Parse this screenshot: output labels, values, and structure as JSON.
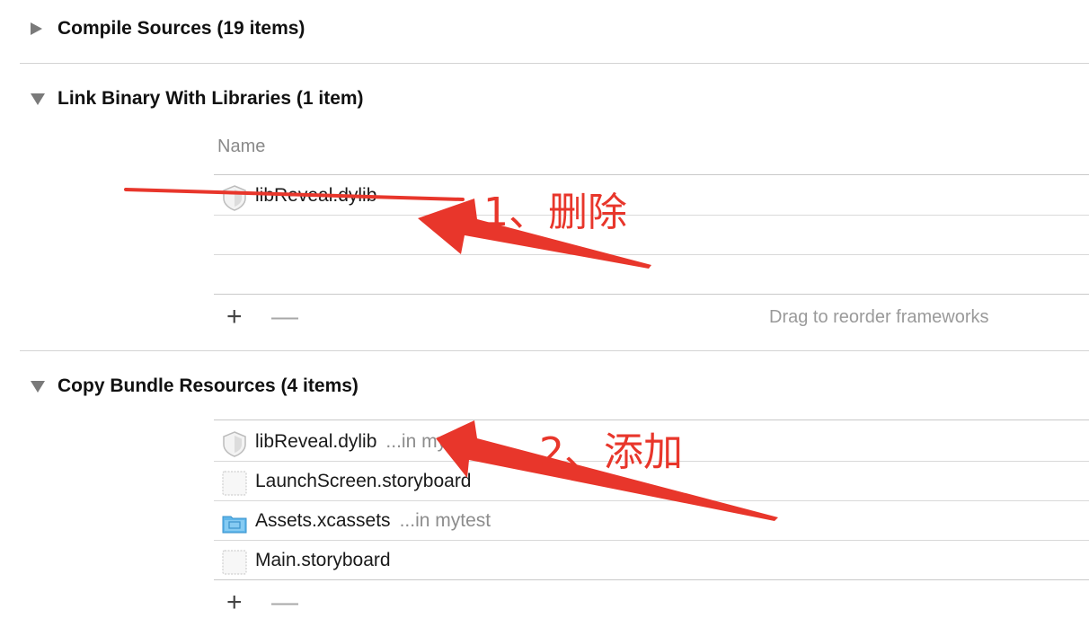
{
  "sections": {
    "compile": {
      "title": "Compile Sources (19 items)"
    },
    "link": {
      "title": "Link Binary With Libraries (1 item)",
      "column_name": "Name",
      "rows": [
        {
          "name": "libReveal.dylib",
          "icon": "library-icon"
        }
      ],
      "add_label": "+",
      "remove_label": "—",
      "hint": "Drag to reorder frameworks"
    },
    "copy": {
      "title": "Copy Bundle Resources (4 items)",
      "rows": [
        {
          "name": "libReveal.dylib",
          "location": "...in mytest",
          "icon": "library-icon"
        },
        {
          "name": "LaunchScreen.storyboard",
          "location": "",
          "icon": "file-icon"
        },
        {
          "name": "Assets.xcassets",
          "location": "...in mytest",
          "icon": "folder-icon"
        },
        {
          "name": "Main.storyboard",
          "location": "",
          "icon": "file-icon"
        }
      ],
      "add_label": "+",
      "remove_label": "—"
    }
  },
  "annotations": {
    "step1": "1、删除",
    "step2": "2、添加",
    "color": "#e8362b"
  }
}
